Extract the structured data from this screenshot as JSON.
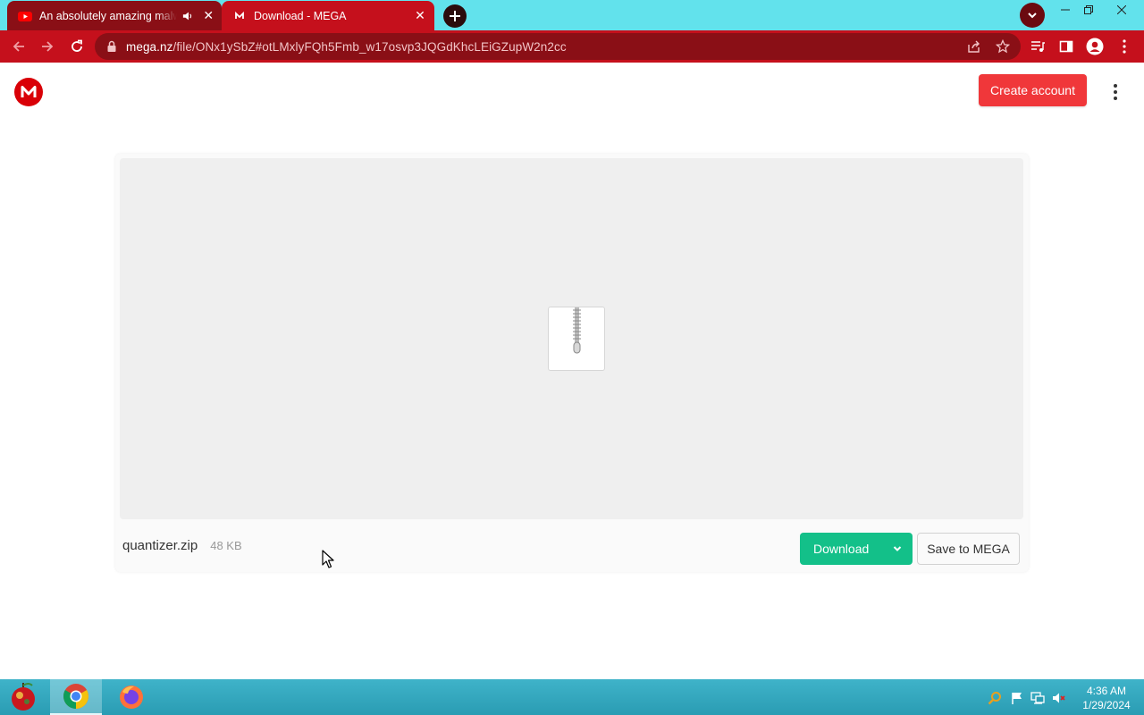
{
  "browser": {
    "tabs": [
      {
        "title": "An absolutely amazing malware",
        "active": false,
        "favicon": "youtube-icon",
        "audio": true
      },
      {
        "title": "Download - MEGA",
        "active": true,
        "favicon": "mega-icon"
      }
    ],
    "url": {
      "host": "mega.nz",
      "path": "/file/ONx1ySbZ#otLMxlyFQh5Fmb_w17osvp3JQGdKhcLEiGZupW2n2cc"
    }
  },
  "header": {
    "logo_letter": "M",
    "create_account_label": "Create account"
  },
  "file": {
    "name": "quantizer.zip",
    "size": "48 KB",
    "icon": "zip-file-icon"
  },
  "actions": {
    "download_label": "Download",
    "save_label": "Save to MEGA"
  },
  "taskbar": {
    "apps": [
      "chrome",
      "firefox"
    ],
    "clock": {
      "time": "4:36 AM",
      "date": "1/29/2024"
    }
  },
  "colors": {
    "tab_strip": "#62e2ec",
    "toolbar": "#c5101c",
    "mega_red": "#d90007",
    "create_account": "#f0373a",
    "download_green": "#13c089"
  }
}
